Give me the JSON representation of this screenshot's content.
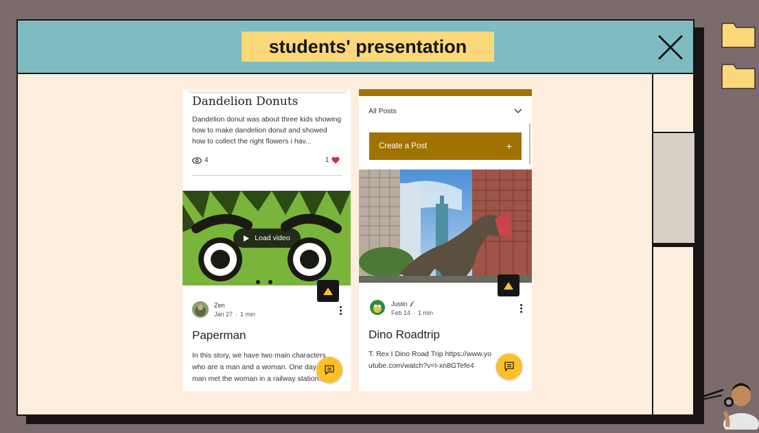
{
  "window": {
    "title": "students' presentation"
  },
  "colors": {
    "titlebar": "#7fbcc1",
    "title_plate": "#fbd87a",
    "window_bg": "#fdeede",
    "desktop": "#7b6b6c",
    "accent_gold": "#a07200",
    "fab": "#fbbf2a"
  },
  "icons": {
    "close": "close-icon",
    "folder": "folder-icon",
    "eye": "eye-icon",
    "heart": "heart-icon",
    "play": "play-icon",
    "chat": "chat-icon",
    "up": "arrow-up-icon",
    "chevron": "chevron-down-icon",
    "quill": "quill-icon"
  },
  "left_phone": {
    "post1": {
      "title": "Dandelion Donuts",
      "excerpt": "Dandelion donut was about three kids showing how to make dandelion donut and showed how to collect the right flowers i hav...",
      "views": "4",
      "likes": "1"
    },
    "video": {
      "load_label": "Load video"
    },
    "post2": {
      "author": "Zen",
      "date": "Jan 27",
      "read_time": "1 min",
      "title": "Paperman",
      "excerpt": "In this story, we have two main characters who are a man and a woman. One day man met the woman in a railway station..."
    }
  },
  "right_phone": {
    "filter": {
      "label": "All Posts"
    },
    "create_post": {
      "label": "Create a Post",
      "plus": "+"
    },
    "post": {
      "author": "Justin",
      "date": "Feb 14",
      "read_time": "1 min",
      "title": "Dino Roadtrip",
      "excerpt": "T. Rex I Dino Road Trip https://www.youtube.com/watch?v=I-xn8GTefe4"
    }
  },
  "separators": {
    "dot": "·"
  }
}
